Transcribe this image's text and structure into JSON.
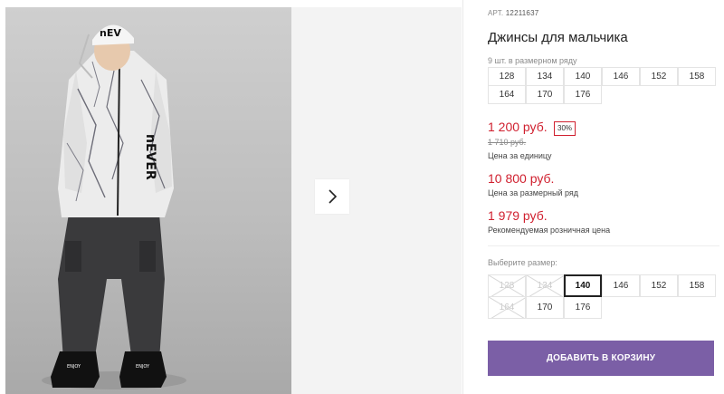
{
  "gallery": {
    "next_icon": "chevron-right-icon",
    "print_text": "nEVER",
    "hat_text": "nEV",
    "boot_text": "ENJOY"
  },
  "product": {
    "sku_label": "АРТ.",
    "sku": "12211637",
    "title": "Джинсы для мальчика",
    "range_caption": "9 шт. в размерном ряду",
    "range_sizes": [
      "128",
      "134",
      "140",
      "146",
      "152",
      "158",
      "164",
      "170",
      "176"
    ]
  },
  "prices": {
    "current": "1 200 руб.",
    "discount": "30%",
    "old": "1 710 руб.",
    "unit_caption": "Цена за единицу",
    "range_total": "10 800 руб.",
    "range_caption": "Цена за размерный ряд",
    "retail": "1 979 руб.",
    "retail_caption": "Рекомендуемая розничная цена"
  },
  "size_select": {
    "caption": "Выберите размер:",
    "selected": "140",
    "sizes": [
      {
        "label": "128",
        "available": false
      },
      {
        "label": "134",
        "available": false
      },
      {
        "label": "140",
        "available": true,
        "selected": true
      },
      {
        "label": "146",
        "available": true
      },
      {
        "label": "152",
        "available": true
      },
      {
        "label": "158",
        "available": true
      },
      {
        "label": "164",
        "available": false
      },
      {
        "label": "170",
        "available": true
      },
      {
        "label": "176",
        "available": true
      }
    ]
  },
  "cart": {
    "button_label": "ДОБАВИТЬ В КОРЗИНУ"
  },
  "colors": {
    "price_red": "#d0202f",
    "accent_purple": "#7b5fa6"
  }
}
